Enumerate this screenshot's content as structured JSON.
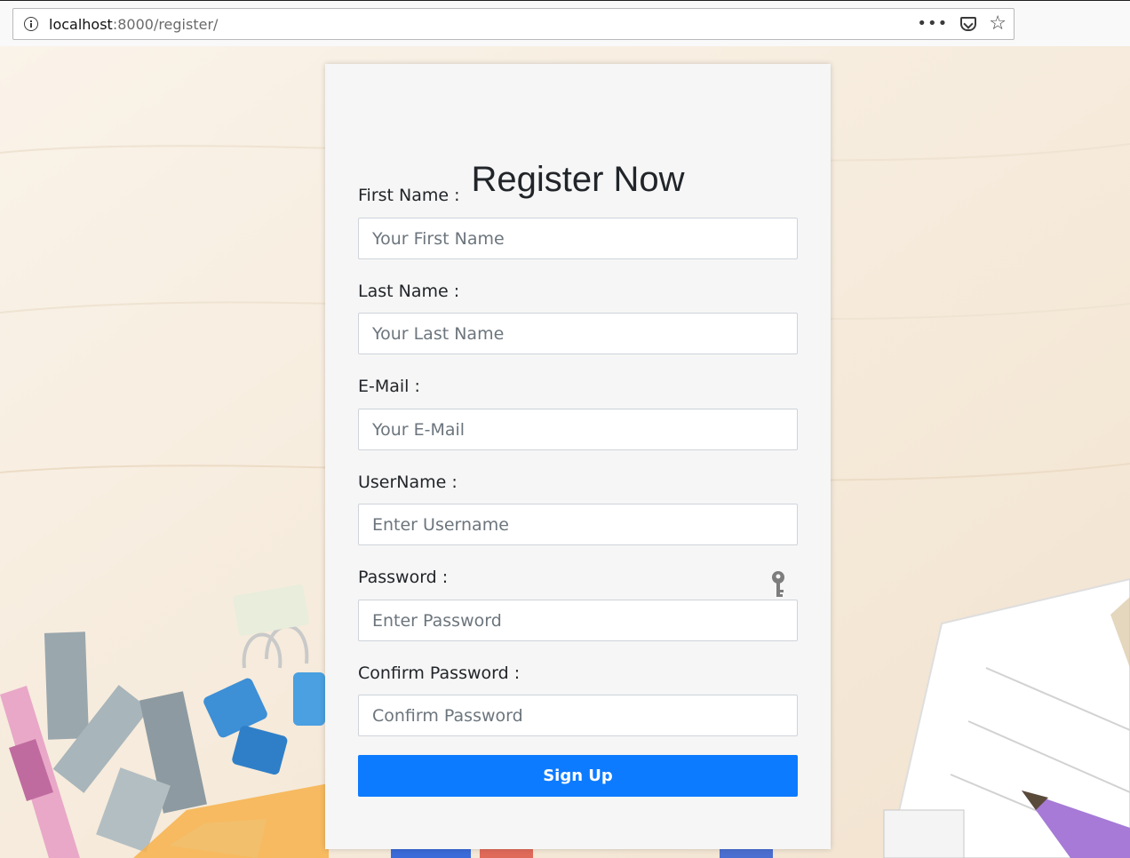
{
  "browser": {
    "url_host": "localhost",
    "url_path": ":8000/register/",
    "icons": [
      "info-icon",
      "more-actions-icon",
      "pocket-icon",
      "bookmark-star-icon"
    ]
  },
  "form": {
    "title": "Register Now",
    "fields": {
      "first_name": {
        "label": "First Name :",
        "placeholder": "Your First Name"
      },
      "last_name": {
        "label": "Last Name :",
        "placeholder": "Your Last Name"
      },
      "email": {
        "label": "E-Mail :",
        "placeholder": "Your E-Mail"
      },
      "username": {
        "label": "UserName :",
        "placeholder": "Enter Username"
      },
      "password": {
        "label": "Password :",
        "placeholder": "Enter Password"
      },
      "confirm_password": {
        "label": "Confirm Password :",
        "placeholder": "Confirm Password"
      }
    },
    "submit_label": "Sign Up"
  },
  "colors": {
    "primary_button": "#0d7bff",
    "card_background": "#f6f6f6",
    "text": "#212529"
  }
}
